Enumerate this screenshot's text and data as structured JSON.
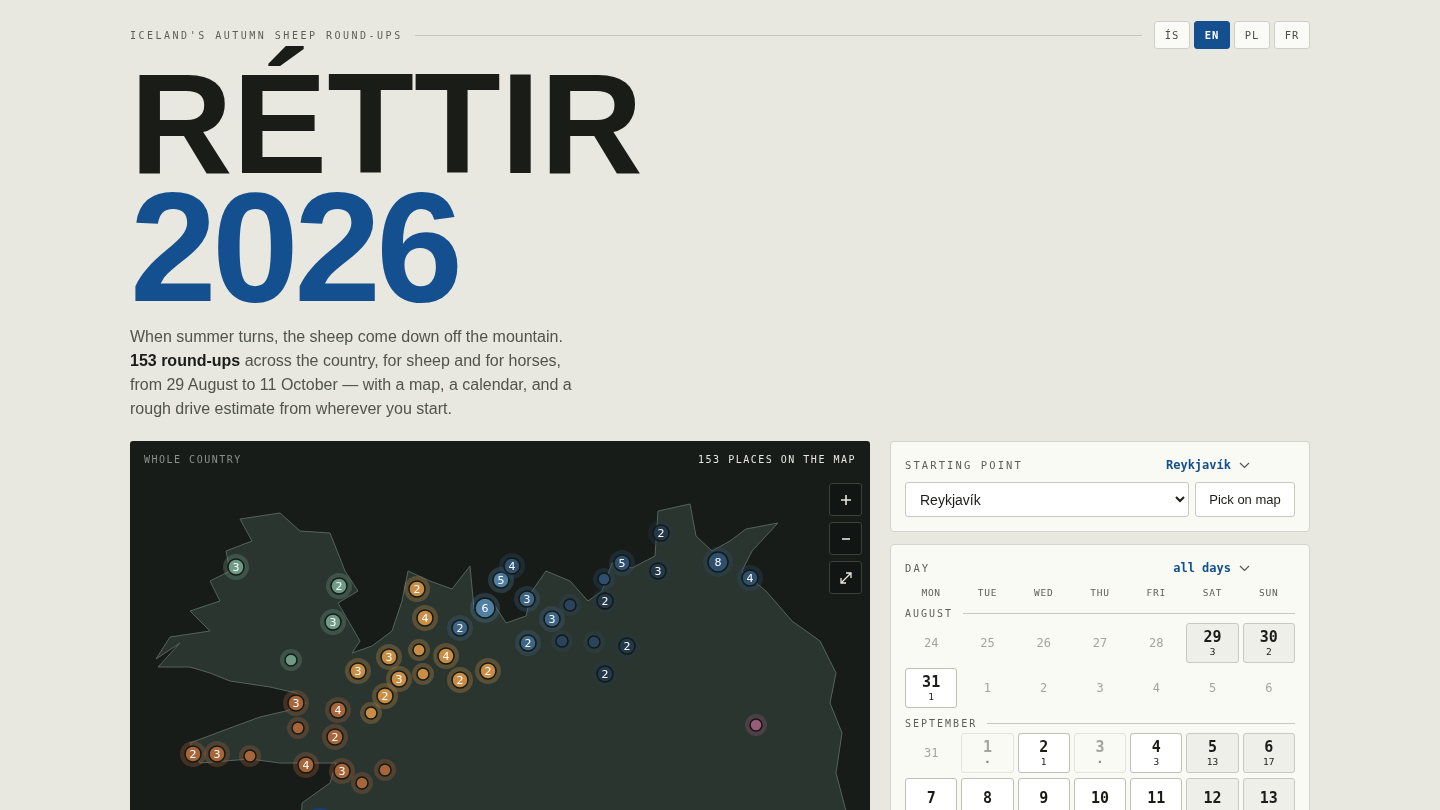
{
  "header": {
    "kicker": "ICELAND'S AUTUMN SHEEP ROUND-UPS",
    "languages": [
      {
        "label": "ÍS",
        "selected": false
      },
      {
        "label": "EN",
        "selected": true
      },
      {
        "label": "PL",
        "selected": false
      },
      {
        "label": "FR",
        "selected": false
      }
    ]
  },
  "title": {
    "line_1": "RÉTTIR",
    "line_2": "2026"
  },
  "intro": "When summer turns, the sheep come down off the mountain. **153 round-ups** across the country, for sheep and for horses, from 29 August to 11 October — with a map, a calendar, and a rough drive estimate from wherever you start.",
  "map": {
    "region": "WHOLE COUNTRY",
    "count_label": "153 PLACES ON THE MAP",
    "markers": [
      {
        "count": "3",
        "color": "#6f9a86"
      },
      {
        "count": "2",
        "color": "#6f9a86"
      },
      {
        "count": "3",
        "color": "#6f9a86"
      },
      {
        "color": "#6f9a86"
      },
      {
        "count": "2",
        "color": "#c98d45"
      },
      {
        "count": "4",
        "color": "#c98d45"
      },
      {
        "count": "3",
        "color": "#c98d45"
      },
      {
        "color": "#c98d45"
      },
      {
        "count": "4",
        "color": "#c98d45"
      },
      {
        "count": "3",
        "color": "#c98d45"
      },
      {
        "count": "3",
        "color": "#c98d45"
      },
      {
        "color": "#c98d45"
      },
      {
        "count": "2",
        "color": "#c98d45"
      },
      {
        "count": "2",
        "color": "#c98d45"
      },
      {
        "count": "2",
        "color": "#c98d45"
      },
      {
        "color": "#c98d45"
      },
      {
        "count": "3",
        "color": "#a8653a"
      },
      {
        "count": "4",
        "color": "#a8653a"
      },
      {
        "color": "#a8653a"
      },
      {
        "count": "2",
        "color": "#a8653a"
      },
      {
        "count": "2",
        "color": "#a8653a"
      },
      {
        "count": "3",
        "color": "#a8653a"
      },
      {
        "color": "#a8653a"
      },
      {
        "count": "4",
        "color": "#a8653a"
      },
      {
        "count": "3",
        "color": "#a8653a"
      },
      {
        "color": "#a8653a"
      },
      {
        "color": "#a8653a"
      },
      {
        "count": "2",
        "color": "#3e6585"
      },
      {
        "count": "6",
        "color": "#4f7fa3"
      },
      {
        "count": "5",
        "color": "#4f7fa3"
      },
      {
        "count": "4",
        "color": "#2f4f6e"
      },
      {
        "count": "3",
        "color": "#3e6585"
      },
      {
        "count": "3",
        "color": "#3e6585"
      },
      {
        "color": "#2a445e"
      },
      {
        "count": "2",
        "color": "#3e6585"
      },
      {
        "color": "#2a445e"
      },
      {
        "color": "#2a445e"
      },
      {
        "count": "2",
        "color": "#24384a"
      },
      {
        "count": "2",
        "color": "#24384a"
      },
      {
        "color": "#2f4f6e"
      },
      {
        "count": "5",
        "color": "#2f4f6e"
      },
      {
        "count": "2",
        "color": "#24384a"
      },
      {
        "count": "3",
        "color": "#24384a"
      },
      {
        "count": "2",
        "color": "#24384a"
      },
      {
        "count": "8",
        "color": "#2f4f6e"
      },
      {
        "count": "4",
        "color": "#2f4f6e"
      },
      {
        "color": "#9a5a7a"
      }
    ]
  },
  "start": {
    "label": "STARTING POINT",
    "current": "Reykjavík",
    "select_value": "Reykjavík",
    "button": "Pick on map"
  },
  "calendar": {
    "label": "DAY",
    "filter": "all days",
    "weekdays": [
      "MON",
      "TUE",
      "WED",
      "THU",
      "FRI",
      "SAT",
      "SUN"
    ],
    "months": [
      {
        "name": "AUGUST",
        "days": [
          {
            "day": "24",
            "kind": "outside"
          },
          {
            "day": "25",
            "kind": "outside"
          },
          {
            "day": "26",
            "kind": "outside"
          },
          {
            "day": "27",
            "kind": "outside"
          },
          {
            "day": "28",
            "kind": "outside"
          },
          {
            "day": "29",
            "count": "3",
            "kind": "weekend"
          },
          {
            "day": "30",
            "count": "2",
            "kind": "weekend"
          },
          {
            "day": "31",
            "count": "1",
            "kind": "open"
          },
          {
            "day": "1",
            "kind": "outside"
          },
          {
            "day": "2",
            "kind": "outside"
          },
          {
            "day": "3",
            "kind": "outside"
          },
          {
            "day": "4",
            "kind": "outside"
          },
          {
            "day": "5",
            "kind": "outside"
          },
          {
            "day": "6",
            "kind": "outside"
          }
        ]
      },
      {
        "name": "SEPTEMBER",
        "days": [
          {
            "day": "31",
            "kind": "outside"
          },
          {
            "day": "1",
            "count": "·",
            "kind": "none"
          },
          {
            "day": "2",
            "count": "1",
            "kind": "open"
          },
          {
            "day": "3",
            "count": "·",
            "kind": "none"
          },
          {
            "day": "4",
            "count": "3",
            "kind": "open"
          },
          {
            "day": "5",
            "count": "13",
            "kind": "weekend"
          },
          {
            "day": "6",
            "count": "17",
            "kind": "weekend"
          },
          {
            "day": "7",
            "kind": "open"
          },
          {
            "day": "8",
            "kind": "open"
          },
          {
            "day": "9",
            "kind": "open"
          },
          {
            "day": "10",
            "kind": "open"
          },
          {
            "day": "11",
            "kind": "open"
          },
          {
            "day": "12",
            "kind": "weekend"
          },
          {
            "day": "13",
            "kind": "weekend"
          }
        ]
      }
    ]
  }
}
